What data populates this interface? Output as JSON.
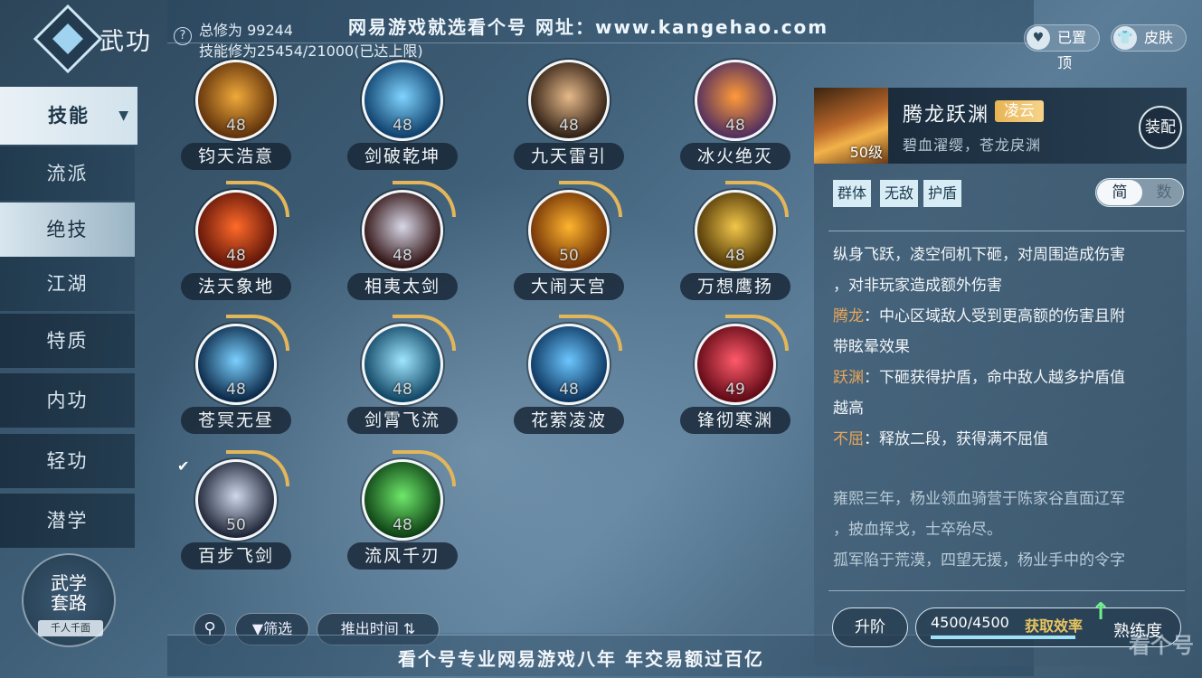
{
  "header": {
    "title": "武功",
    "stat_total": "总修为 99244",
    "stat_skill": "技能修为25454/21000(已达上限)",
    "watermark_top": "网易游戏就选看个号  网址：www.kangehao.com",
    "pinned_label": "已置顶",
    "skin_label": "皮肤"
  },
  "sidebar": {
    "items": [
      {
        "label": "技能"
      },
      {
        "label": "流派"
      },
      {
        "label": "绝技"
      },
      {
        "label": "江湖"
      },
      {
        "label": "特质"
      },
      {
        "label": "内功"
      },
      {
        "label": "轻功"
      },
      {
        "label": "潜学"
      }
    ],
    "wuxue": {
      "line1": "武学",
      "line2": "套路",
      "sub": "千人千面"
    }
  },
  "skills": [
    {
      "name": "钧天浩意",
      "level": "48",
      "colors": [
        "#5a2d0a",
        "#f0a93a"
      ]
    },
    {
      "name": "剑破乾坤",
      "level": "48",
      "colors": [
        "#0b3a66",
        "#7fd4ff"
      ]
    },
    {
      "name": "九天雷引",
      "level": "48",
      "colors": [
        "#2a1a10",
        "#e6b98a"
      ]
    },
    {
      "name": "冰火绝灭",
      "level": "48",
      "colors": [
        "#4a2a60",
        "#ff9a3a"
      ]
    },
    {
      "name": "法天象地",
      "level": "48",
      "colors": [
        "#5a1208",
        "#ff6a2a"
      ]
    },
    {
      "name": "相夷太剑",
      "level": "48",
      "colors": [
        "#2a0a0a",
        "#d8d8e8"
      ]
    },
    {
      "name": "大闹天宫",
      "level": "50",
      "colors": [
        "#6a2c05",
        "#ffb42e"
      ]
    },
    {
      "name": "万想鹰扬",
      "level": "48",
      "colors": [
        "#4a3205",
        "#f2c64a"
      ]
    },
    {
      "name": "苍冥无昼",
      "level": "48",
      "colors": [
        "#06203e",
        "#7ad0ff"
      ]
    },
    {
      "name": "剑霄飞流",
      "level": "48",
      "colors": [
        "#0a3f5e",
        "#9fe6ff"
      ]
    },
    {
      "name": "花萦凌波",
      "level": "48",
      "colors": [
        "#082f58",
        "#6cc6ff"
      ]
    },
    {
      "name": "锋彻寒渊",
      "level": "49",
      "colors": [
        "#5a0612",
        "#ff5a6a"
      ]
    },
    {
      "name": "百步飞剑",
      "level": "50",
      "colors": [
        "#161e30",
        "#cfd8ea"
      ]
    },
    {
      "name": "流风千刃",
      "level": "48",
      "colors": [
        "#0a3a12",
        "#6ee86a"
      ]
    }
  ],
  "toolbar": {
    "search_icon": "search-icon",
    "filter_label": "筛选",
    "sort_label": "推出时间"
  },
  "watermark_bottom": "看个号专业网易游戏八年  年交易额过百亿",
  "detail": {
    "level_label": "50级",
    "title": "腾龙跃渊",
    "tag": "凌云",
    "subtitle": "碧血濯缨，苍龙戾渊",
    "equip_label": "装配",
    "attrs": [
      "群体",
      "无敌",
      "护盾"
    ],
    "toggle_on": "简",
    "toggle_off": "数",
    "desc_line1": "纵身飞跃，凌空伺机下砸，对周围造成伤害",
    "desc_line2": "，对非玩家造成额外伤害",
    "k1": "腾龙",
    "k1_text": "：中心区域敌人受到更高额的伤害且附",
    "k1_text2": "带眩晕效果",
    "k2": "跃渊",
    "k2_text": "：下砸获得护盾，命中敌人越多护盾值",
    "k2_text2": "越高",
    "k3": "不屈",
    "k3_text": "：释放二段，获得满不屈值",
    "lore1": "雍熙三年，杨业领血骑营于陈家谷直面辽军",
    "lore2": "，披血挥戈，士卒殆尽。",
    "lore3": "孤军陷于荒漠，四望无援，杨业手中的令字"
  },
  "footer": {
    "upgrade_label": "升阶",
    "prof_value": "4500/4500",
    "prof_fraction": 1.0,
    "efficiency_label": "获取效率",
    "prof_label": "熟练度",
    "watermark_logo": "看个号"
  }
}
